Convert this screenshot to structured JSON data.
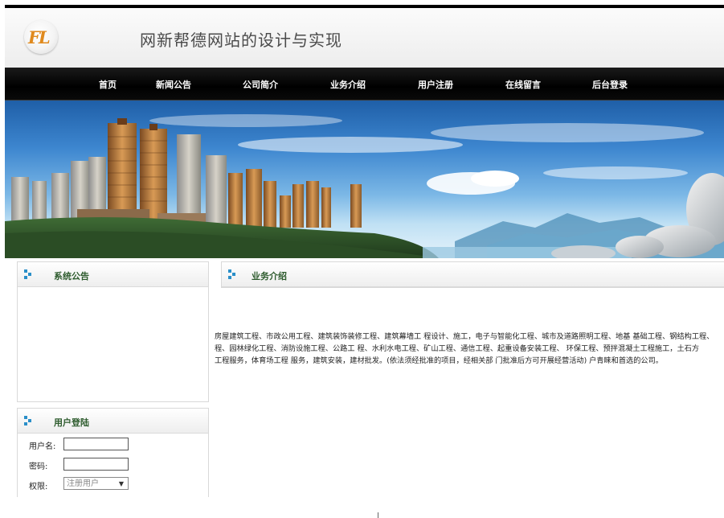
{
  "site": {
    "logo_text": "FL",
    "title": "网新帮德网站的设计与实现"
  },
  "nav": {
    "items": [
      {
        "label": "首页"
      },
      {
        "label": "新闻公告"
      },
      {
        "label": "公司简介"
      },
      {
        "label": "业务介绍"
      },
      {
        "label": "用户注册"
      },
      {
        "label": "在线留言"
      },
      {
        "label": "后台登录"
      }
    ]
  },
  "sidebar": {
    "notice_title": "系统公告",
    "login_title": "用户登陆",
    "login": {
      "username_label": "用户名:",
      "username_value": "",
      "password_label": "密码:",
      "password_value": "",
      "role_label": "权限:",
      "role_selected": "注册用户",
      "role_arrow": "▼"
    }
  },
  "main": {
    "section_title": "业务介绍",
    "intro_lines": [
      "房屋建筑工程、市政公用工程、建筑装饰装修工程、建筑幕墙工 程设计、施工，电子与智能化工程、城市及道路照明工程、地基 基础工程、钢结构工程、",
      "程、园林绿化工程、消防设施工程、公路工 程、水利水电工程、矿山工程、通信工程、起重设备安装工程、 环保工程、预拌混凝土工程施工，土石方",
      "工程服务，体育场工程 服务，建筑安装，建材批发。(依法须经批准的项目，经相关部 门批准后方可开展经营活动) 户青睐和首选的公司。"
    ]
  },
  "colors": {
    "nav_bg": "#000000",
    "panel_title": "#2d5b2d",
    "bullet": "#2a8fc9"
  }
}
